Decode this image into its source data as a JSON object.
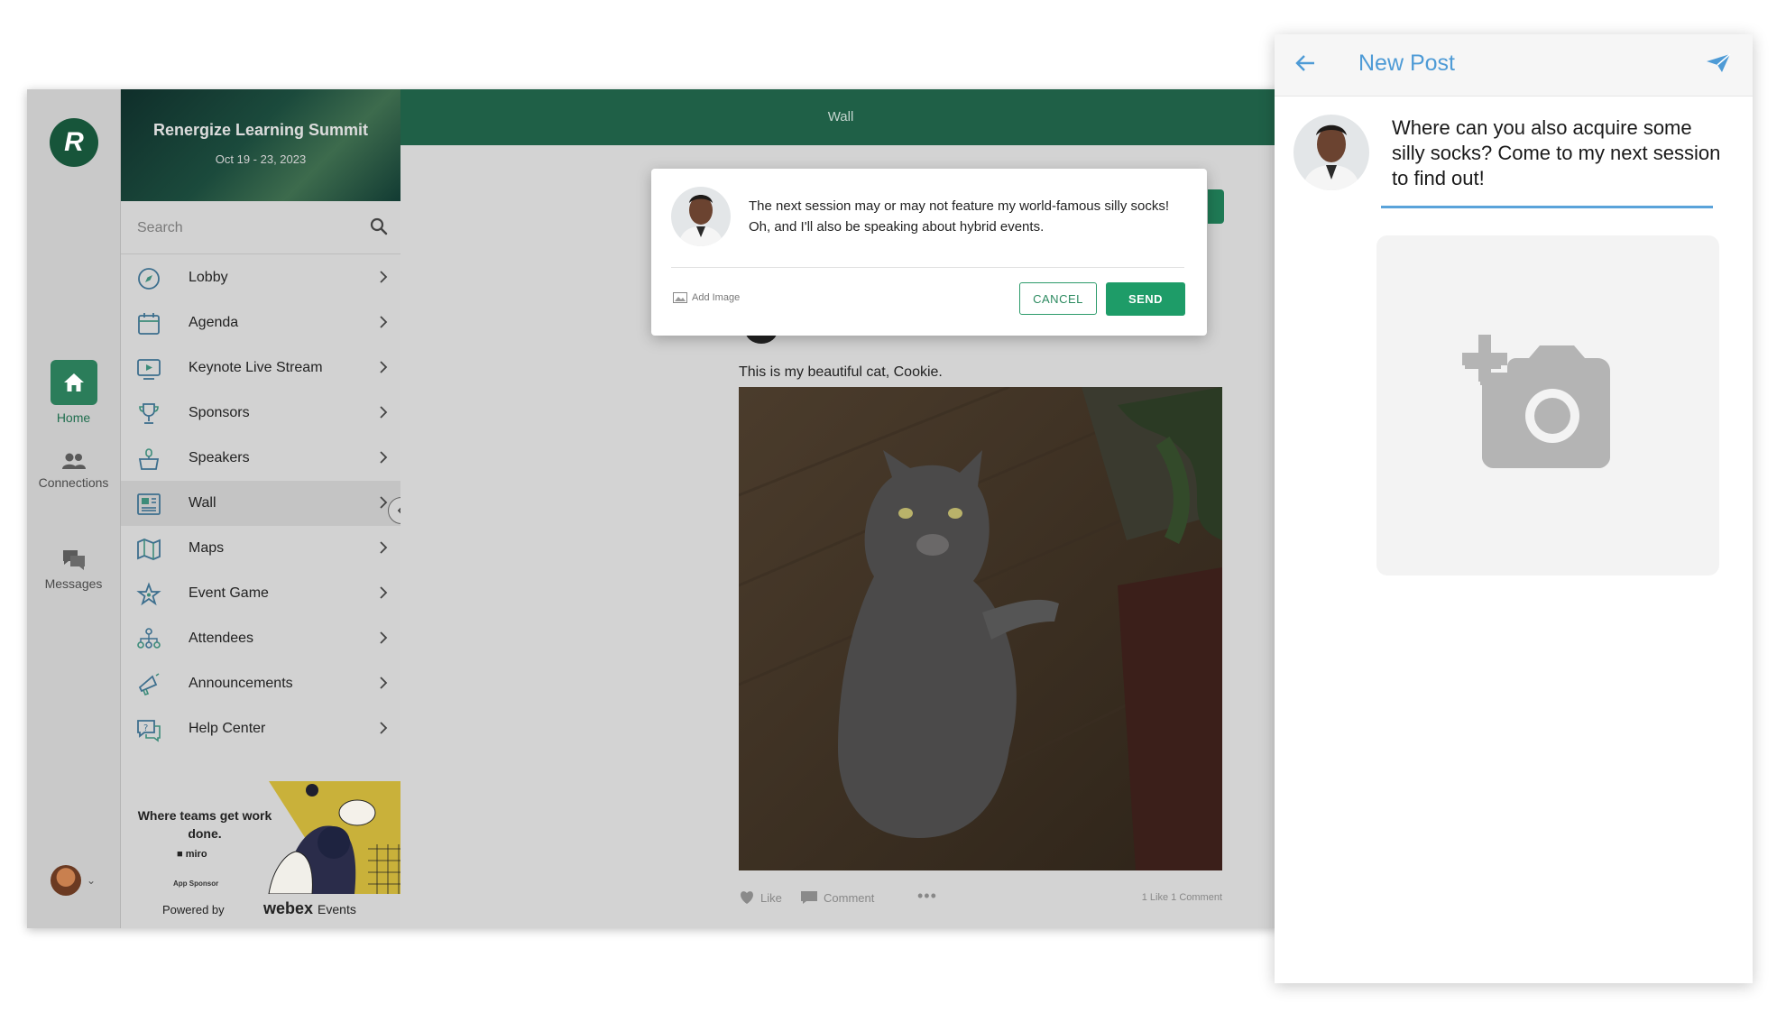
{
  "event": {
    "name": "Renergize Learning Summit",
    "dates": "Oct 19 - 23, 2023"
  },
  "rail": {
    "items": [
      {
        "label": "Home",
        "icon": "home-icon",
        "active": true
      },
      {
        "label": "Connections",
        "icon": "people-icon"
      },
      {
        "label": "Messages",
        "icon": "chat-bubbles-icon"
      }
    ]
  },
  "sidebar": {
    "search_placeholder": "Search",
    "items": [
      {
        "label": "Lobby",
        "icon": "compass-icon"
      },
      {
        "label": "Agenda",
        "icon": "calendar-icon"
      },
      {
        "label": "Keynote Live Stream",
        "icon": "video-screen-icon"
      },
      {
        "label": "Sponsors",
        "icon": "trophy-icon"
      },
      {
        "label": "Speakers",
        "icon": "podium-icon"
      },
      {
        "label": "Wall",
        "icon": "newspaper-icon",
        "selected": true
      },
      {
        "label": "Maps",
        "icon": "map-icon"
      },
      {
        "label": "Event Game",
        "icon": "star-icon"
      },
      {
        "label": "Attendees",
        "icon": "org-chart-icon"
      },
      {
        "label": "Announcements",
        "icon": "megaphone-icon"
      },
      {
        "label": "Help Center",
        "icon": "help-chat-icon"
      }
    ],
    "sponsor": {
      "tagline": "Where teams get work done.",
      "brand": "miro",
      "role": "App Sponsor"
    },
    "powered_by": "Powered by",
    "powered_brand": "webex",
    "powered_brand_suffix": "Events"
  },
  "main": {
    "title": "Wall",
    "post": {
      "caption": "This is my beautiful cat, Cookie.",
      "like_label": "Like",
      "comment_label": "Comment",
      "stats": "1 Like  1 Comment"
    }
  },
  "dialog": {
    "message": "The next session may or may not feature my world-famous silly socks! Oh, and I'll also be speaking about hybrid events.",
    "add_image_label": "Add Image",
    "cancel_label": "CANCEL",
    "send_label": "SEND"
  },
  "mobile": {
    "title": "New Post",
    "message": "Where can you also acquire some silly socks? Come to my next session to find out!"
  },
  "colors": {
    "brand_green": "#1f6047",
    "send_green": "#1e9c68",
    "mobile_blue": "#4e9bd6"
  }
}
